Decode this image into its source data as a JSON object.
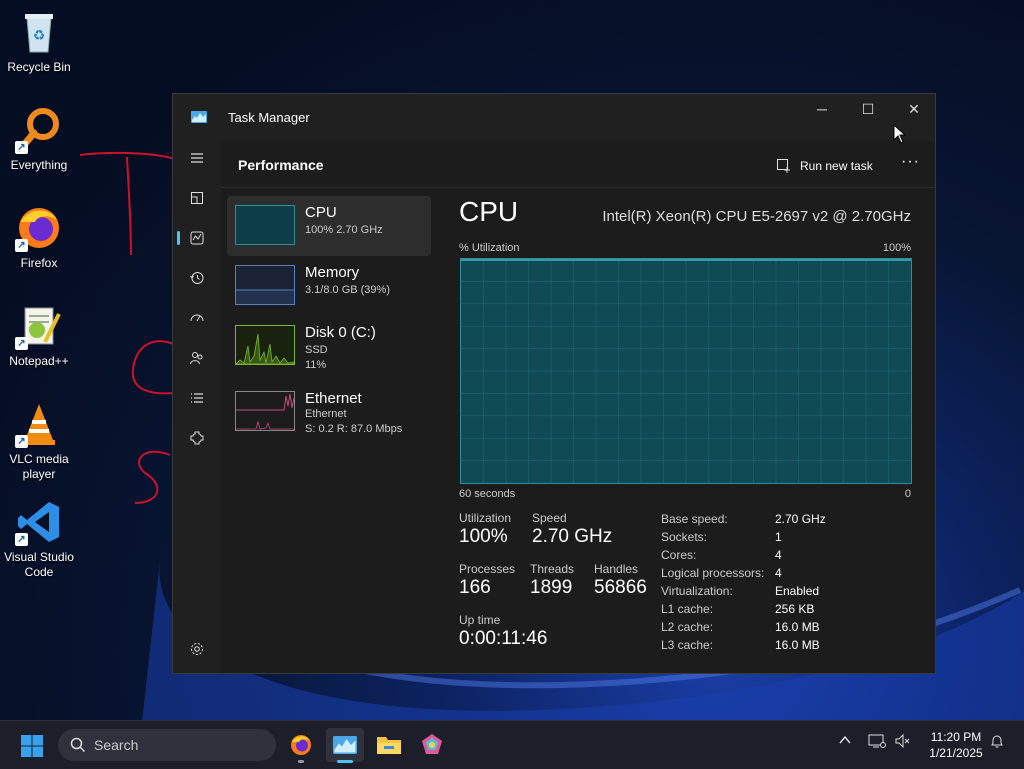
{
  "desktop": {
    "icons": [
      {
        "label": "Recycle Bin",
        "icon": "recycle-bin-icon"
      },
      {
        "label": "Everything",
        "icon": "everything-search-icon"
      },
      {
        "label": "Firefox",
        "icon": "firefox-icon"
      },
      {
        "label": "Notepad++",
        "icon": "notepadpp-icon"
      },
      {
        "label": "VLC media player",
        "icon": "vlc-icon"
      },
      {
        "label": "Visual Studio Code",
        "icon": "vscode-icon"
      }
    ]
  },
  "window": {
    "title": "Task Manager",
    "minimize": "─",
    "maximize": "☐",
    "close": "✕"
  },
  "header": {
    "title": "Performance",
    "run_new_task": "Run new task",
    "more": "···"
  },
  "nav": [
    "menu-icon",
    "processes-icon",
    "performance-icon",
    "app-history-icon",
    "startup-apps-icon",
    "users-icon",
    "details-icon",
    "services-icon",
    "settings-icon"
  ],
  "resources": [
    {
      "name": "CPU",
      "line1": "100%  2.70 GHz",
      "line2": "",
      "color": "#2b8e98"
    },
    {
      "name": "Memory",
      "line1": "3.1/8.0 GB (39%)",
      "line2": "",
      "color": "#5a7fbf"
    },
    {
      "name": "Disk 0 (C:)",
      "line1": "SSD",
      "line2": "11%",
      "color": "#7cb82f"
    },
    {
      "name": "Ethernet",
      "line1": "Ethernet",
      "line2": "S: 0.2  R: 87.0 Mbps",
      "color": "#c24c7a"
    }
  ],
  "cpu": {
    "title": "CPU",
    "model": "Intel(R) Xeon(R) CPU E5-2697 v2 @ 2.70GHz",
    "y_label": "% Utilization",
    "y_max": "100%",
    "x_label": "60 seconds",
    "x_min": "0",
    "utilization_value": 1.0,
    "stats": {
      "utilization_label": "Utilization",
      "utilization": "100%",
      "speed_label": "Speed",
      "speed": "2.70 GHz",
      "processes_label": "Processes",
      "processes": "166",
      "threads_label": "Threads",
      "threads": "1899",
      "handles_label": "Handles",
      "handles": "56866",
      "uptime_label": "Up time",
      "uptime": "0:00:11:46"
    },
    "specs": [
      {
        "label": "Base speed:",
        "value": "2.70 GHz"
      },
      {
        "label": "Sockets:",
        "value": "1"
      },
      {
        "label": "Cores:",
        "value": "4"
      },
      {
        "label": "Logical processors:",
        "value": "4"
      },
      {
        "label": "Virtualization:",
        "value": "Enabled"
      },
      {
        "label": "L1 cache:",
        "value": "256 KB"
      },
      {
        "label": "L2 cache:",
        "value": "16.0 MB"
      },
      {
        "label": "L3 cache:",
        "value": "16.0 MB"
      }
    ]
  },
  "taskbar": {
    "search_placeholder": "Search",
    "apps": [
      "firefox-icon",
      "task-manager-icon",
      "file-explorer-icon",
      "app-icon"
    ],
    "time": "11:20 PM",
    "date": "1/21/2025"
  },
  "colors": {
    "accent": "#4cc2ff",
    "cpu": "#2b8e98",
    "annotation": "#d0102a"
  }
}
